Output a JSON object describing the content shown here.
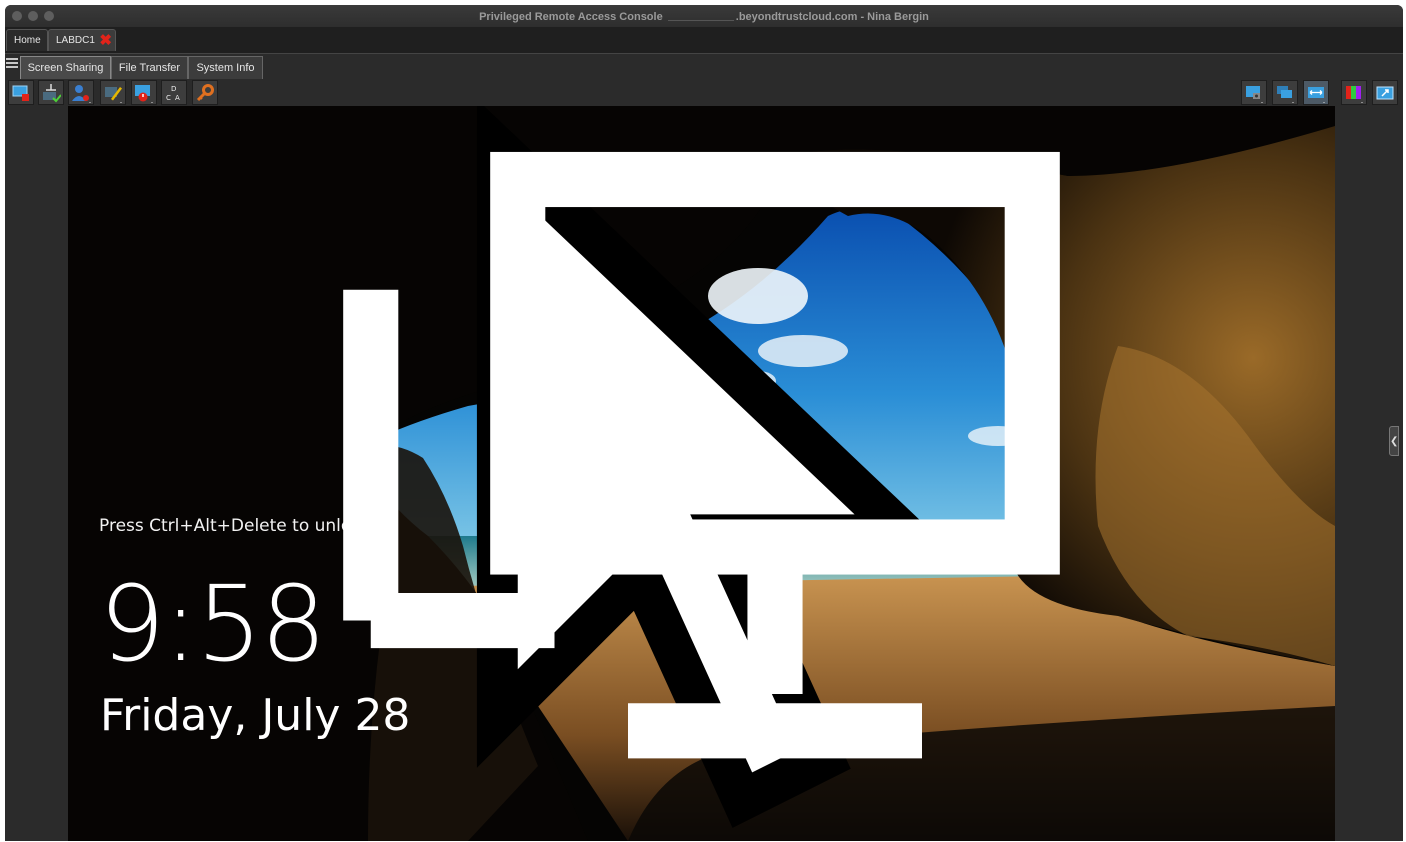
{
  "window": {
    "title_prefix": "Privileged Remote Access Console",
    "title_suffix": ".beyondtrustcloud.com - Nina Bergin"
  },
  "tabs": [
    {
      "label": "Home"
    },
    {
      "label": "LABDC1"
    }
  ],
  "session_tabs": [
    {
      "label": "Screen Sharing",
      "active": true
    },
    {
      "label": "File Transfer",
      "active": false
    },
    {
      "label": "System Info",
      "active": false
    }
  ],
  "toolbar": {
    "left_icons": [
      "stop-screen-sharing-icon",
      "privacy-screen-icon",
      "user-elevation-icon",
      "annotations-icon",
      "power-options-icon",
      "ctrl-alt-del-icon",
      "credential-injection-icon"
    ],
    "right_icons": [
      "screenshot-icon",
      "monitor-select-icon",
      "scale-screen-icon",
      "color-quality-icon",
      "full-screen-icon"
    ]
  },
  "remote_screen": {
    "lock_hint": "Press Ctrl+Alt+Delete to unlock.",
    "time": "9:58",
    "date": "Friday, July 28"
  },
  "colors": {
    "window_bg": "#2b2b2b",
    "tab_close": "#e2231a"
  }
}
